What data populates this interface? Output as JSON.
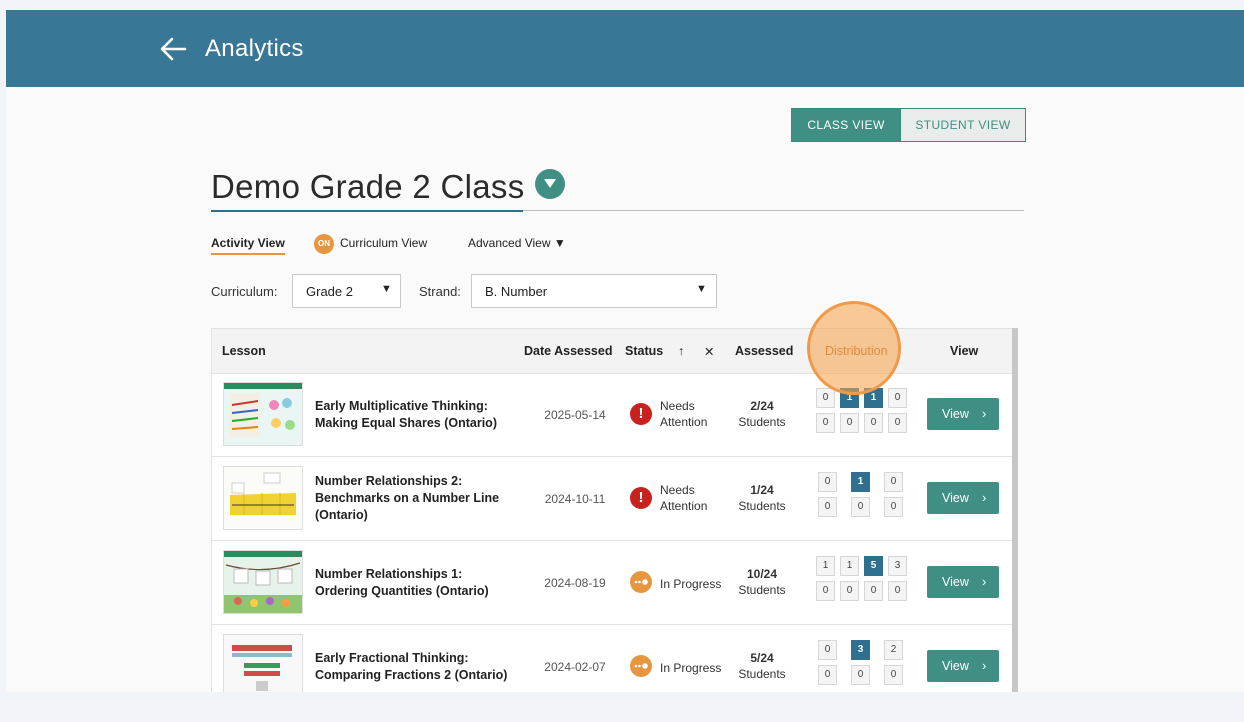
{
  "header": {
    "title": "Analytics"
  },
  "view_toggle": {
    "class_view": "CLASS VIEW",
    "student_view": "STUDENT VIEW"
  },
  "class": {
    "name": "Demo Grade 2 Class"
  },
  "view_tabs": {
    "activity": "Activity View",
    "curriculum_badge": "ON",
    "curriculum": "Curriculum View",
    "advanced": "Advanced View ▼"
  },
  "filters": {
    "curriculum_label": "Curriculum:",
    "curriculum_value": "Grade 2",
    "strand_label": "Strand:",
    "strand_value": "B. Number",
    "caret": "▼"
  },
  "table": {
    "headers": {
      "lesson": "Lesson",
      "date": "Date Assessed",
      "status": "Status",
      "sort": "↑",
      "clear": "✕",
      "assessed": "Assessed",
      "distribution": "Distribution",
      "view": "View"
    },
    "rows": [
      {
        "lesson": "Early Multiplicative Thinking: Making Equal Shares (Ontario)",
        "date": "2025-05-14",
        "status": "Needs Attention",
        "status_type": "needs",
        "assessed": "2/24",
        "assessed_unit": "Students",
        "dist_top": [
          "0",
          "1",
          "1",
          "0"
        ],
        "dist_bottom": [
          "0",
          "0",
          "0",
          "0"
        ],
        "view": "View"
      },
      {
        "lesson": "Number Relationships 2: Benchmarks on a Number Line (Ontario)",
        "date": "2024-10-11",
        "status": "Needs Attention",
        "status_type": "needs",
        "assessed": "1/24",
        "assessed_unit": "Students",
        "dist_top": [
          "0",
          "1",
          "0"
        ],
        "dist_bottom": [
          "0",
          "0",
          "0"
        ],
        "view": "View"
      },
      {
        "lesson": "Number Relationships 1: Ordering Quantities (Ontario)",
        "date": "2024-08-19",
        "status": "In Progress",
        "status_type": "progress",
        "assessed": "10/24",
        "assessed_unit": "Students",
        "dist_top": [
          "1",
          "1",
          "5",
          "3"
        ],
        "dist_bottom": [
          "0",
          "0",
          "0",
          "0"
        ],
        "view": "View"
      },
      {
        "lesson": "Early Fractional Thinking: Comparing Fractions 2 (Ontario)",
        "date": "2024-02-07",
        "status": "In Progress",
        "status_type": "progress",
        "assessed": "5/24",
        "assessed_unit": "Students",
        "dist_top": [
          "0",
          "3",
          "2"
        ],
        "dist_bottom": [
          "0",
          "0",
          "0"
        ],
        "view": "View"
      }
    ]
  },
  "colors": {
    "header": "#387795",
    "teal": "#3f8f84",
    "orange": "#e6963e",
    "red": "#c8211e",
    "dist_highlight": "#2f6f8f"
  }
}
